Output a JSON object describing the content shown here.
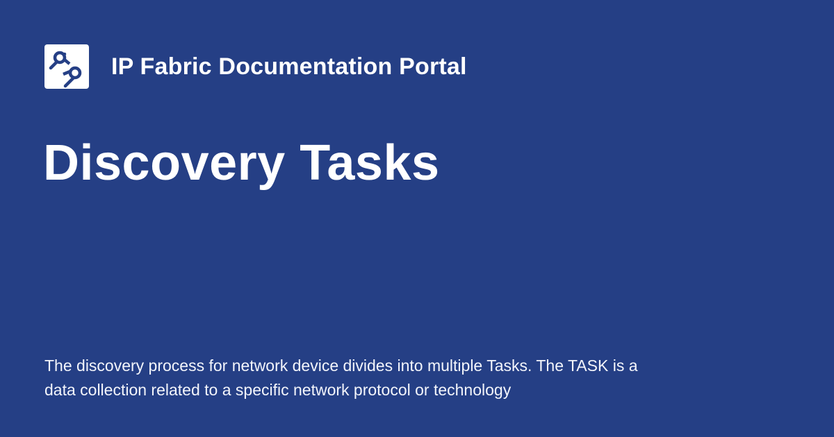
{
  "site": {
    "name": "IP Fabric Documentation Portal",
    "logo_icon": "ipfabric-logo-icon"
  },
  "page": {
    "title": "Discovery Tasks",
    "description": "The discovery process for network device divides into multiple Tasks. The TASK is a data collection related to a specific network protocol or technology"
  },
  "colors": {
    "background": "#253f85",
    "text": "#ffffff",
    "logo_background": "#ffffff",
    "logo_foreground": "#253f85"
  }
}
